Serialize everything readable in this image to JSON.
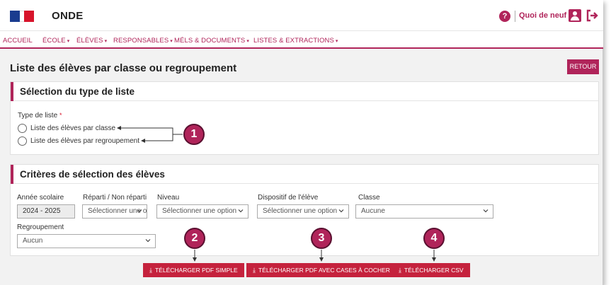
{
  "header": {
    "app_title": "ONDE",
    "help_icon": "help-icon",
    "help_glyph": "?",
    "news_label": "Quoi de neuf",
    "user_icon": "user-icon",
    "logout_icon": "logout-icon",
    "accent_color": "#b0245a"
  },
  "nav": {
    "items": [
      {
        "label": "ACCUEIL",
        "caret": ""
      },
      {
        "label": "ÉCOLE",
        "caret": "▾"
      },
      {
        "label": "ÉLÈVES",
        "caret": "▾"
      },
      {
        "label": "RESPONSABLES",
        "caret": "▾"
      },
      {
        "label": "MÉLS & DOCUMENTS",
        "caret": "▾"
      },
      {
        "label": "LISTES & EXTRACTIONS",
        "caret": "▾"
      }
    ]
  },
  "page": {
    "title": "Liste des élèves par classe ou regroupement",
    "back_label": "RETOUR"
  },
  "type_panel": {
    "title": "Sélection du type de liste",
    "field_label": "Type de liste",
    "required_mark": "*",
    "options": [
      {
        "label": "Liste des élèves par classe"
      },
      {
        "label": "Liste des élèves par regroupement"
      }
    ]
  },
  "criteria_panel": {
    "title": "Critères de sélection des élèves",
    "annee": {
      "label": "Année scolaire",
      "value": "2024 - 2025"
    },
    "reparti": {
      "label": "Réparti / Non réparti",
      "value": "Sélectionner une option"
    },
    "niveau": {
      "label": "Niveau",
      "value": "Sélectionner une option"
    },
    "dispositif": {
      "label": "Dispositif de l'élève",
      "value": "Sélectionner une option"
    },
    "classe": {
      "label": "Classe",
      "value": "Aucune"
    },
    "regroupement": {
      "label": "Regroupement",
      "value": "Aucun"
    }
  },
  "actions": {
    "download_icon": "download-icon",
    "download_glyph": "⤓",
    "pdf_simple": "TÉLÉCHARGER PDF SIMPLE",
    "pdf_checkbox": "TÉLÉCHARGER PDF AVEC CASES À COCHER",
    "csv": "TÉLÉCHARGER CSV"
  },
  "callouts": [
    "1",
    "2",
    "3",
    "4"
  ]
}
